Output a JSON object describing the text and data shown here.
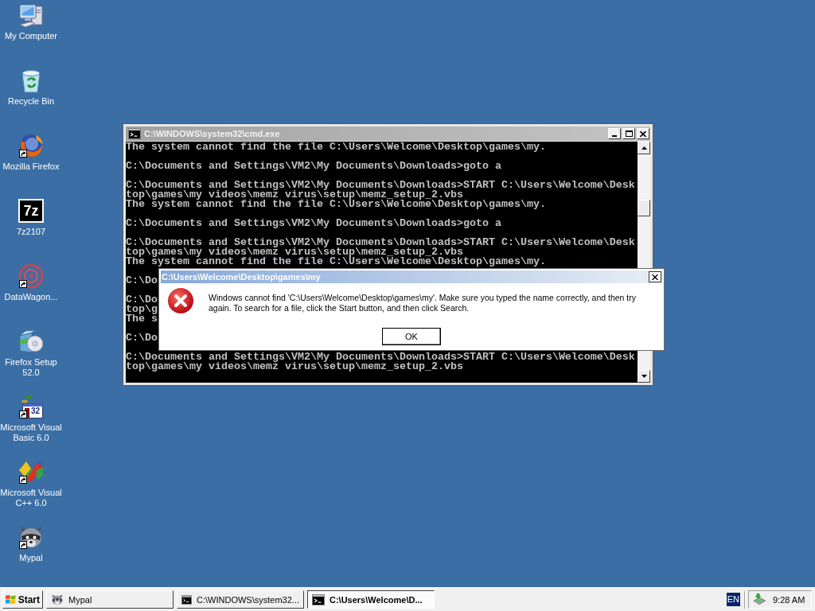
{
  "desktop_icons": [
    {
      "label": "My Computer",
      "kind": "computer",
      "shortcut": false
    },
    {
      "label": "Recycle Bin",
      "kind": "recycle-bin",
      "shortcut": false
    },
    {
      "label": "Mozilla Firefox",
      "kind": "browser",
      "shortcut": true
    },
    {
      "label": "7z2107",
      "kind": "archive",
      "icon_text": "7z",
      "shortcut": false
    },
    {
      "label": "DataWagon...",
      "kind": "target",
      "shortcut": true
    },
    {
      "label": "Firefox Setup 52.0",
      "kind": "installer",
      "shortcut": false
    },
    {
      "label": "Microsoft Visual Basic 6.0",
      "kind": "vb",
      "icon_text": "32",
      "shortcut": true
    },
    {
      "label": "Microsoft Visual C++ 6.0",
      "kind": "vc",
      "shortcut": true
    },
    {
      "label": "Mypal",
      "kind": "raccoon",
      "shortcut": true
    }
  ],
  "console_window": {
    "title": "C:\\WINDOWS\\system32\\cmd.exe",
    "active": false,
    "paragraphs": [
      [
        "The system cannot find the file C:\\Users\\Welcome\\Desktop\\games\\my."
      ],
      [
        "C:\\Documents and Settings\\VM2\\My Documents\\Downloads>goto a"
      ],
      [
        "C:\\Documents and Settings\\VM2\\My Documents\\Downloads>START C:\\Users\\Welcome\\Desk",
        "top\\games\\my videos\\memz virus\\setup\\memz_setup_2.vbs",
        "The system cannot find the file C:\\Users\\Welcome\\Desktop\\games\\my."
      ],
      [
        "C:\\Documents and Settings\\VM2\\My Documents\\Downloads>goto a"
      ],
      [
        "C:\\Documents and Settings\\VM2\\My Documents\\Downloads>START C:\\Users\\Welcome\\Desk",
        "top\\games\\my videos\\memz virus\\setup\\memz_setup_2.vbs",
        "The system cannot find the file C:\\Users\\Welcome\\Desktop\\games\\my."
      ],
      [
        "C:\\Do"
      ],
      [
        "C:\\Do",
        "top\\g",
        "The s"
      ],
      [
        "C:\\Do"
      ],
      [
        "C:\\Documents and Settings\\VM2\\My Documents\\Downloads>START C:\\Users\\Welcome\\Desk",
        "top\\games\\my videos\\memz virus\\setup\\memz_setup_2.vbs"
      ]
    ]
  },
  "error_dialog": {
    "title": "C:\\Users\\Welcome\\Desktop\\games\\my",
    "active": true,
    "message": "Windows cannot find 'C:\\Users\\Welcome\\Desktop\\games\\my'. Make sure you typed the name correctly, and then try again. To search for a file, click the Start button, and then click Search.",
    "button": "OK"
  },
  "taskbar": {
    "start_button": "Start",
    "tasks": [
      {
        "label": "Mypal",
        "kind": "raccoon",
        "selected": false
      },
      {
        "label": "C:\\WINDOWS\\system32...",
        "kind": "console",
        "selected": false
      },
      {
        "label": "C:\\Users\\Welcome\\D...",
        "kind": "console",
        "selected": true
      }
    ],
    "language": "EN",
    "clock": "9:28 AM"
  }
}
